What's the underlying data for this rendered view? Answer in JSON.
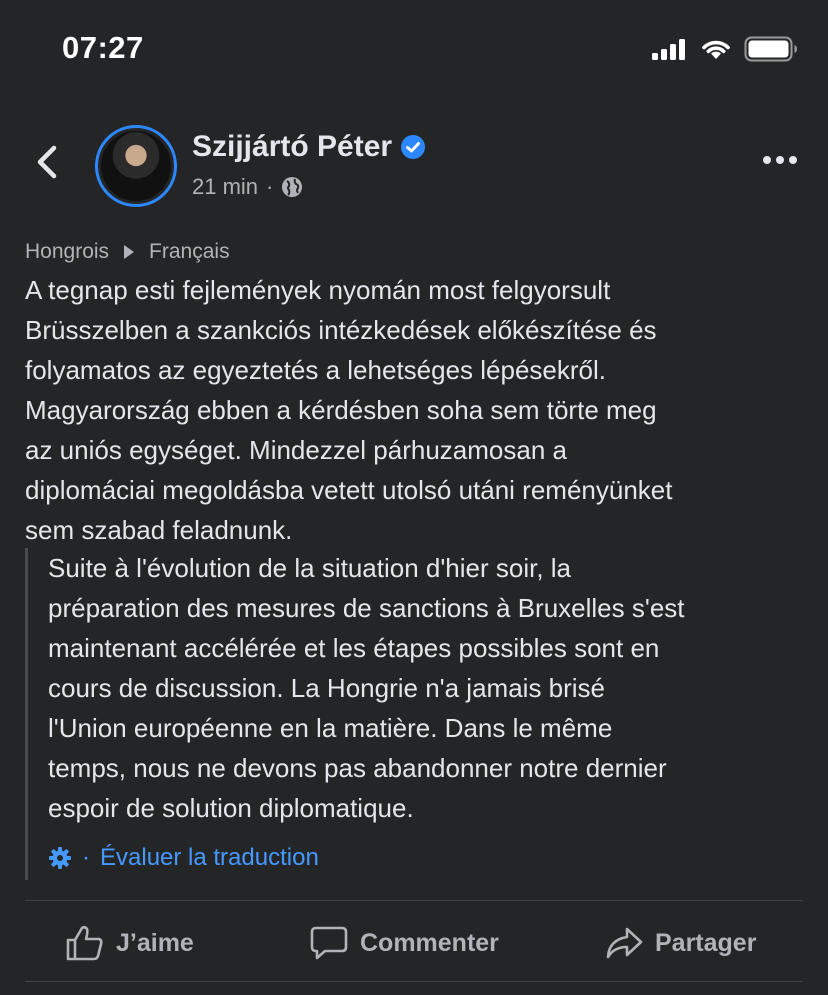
{
  "status_bar": {
    "time": "07:27"
  },
  "post": {
    "author": "Szijjártó Péter",
    "timestamp": "21 min",
    "separator": "·"
  },
  "translation": {
    "from_lang": "Hongrois",
    "to_lang": "Français",
    "original_lines": [
      "A tegnap esti fejlemények nyomán most felgyorsult",
      "Brüsszelben a szankciós intézkedések előkészítése és",
      "folyamatos az egyeztetés a lehetséges lépésekről.",
      "Magyarország ebben a kérdésben soha sem törte meg",
      "az uniós egységet. Mindezzel párhuzamosan a",
      "diplomáciai megoldásba vetett utolsó utáni reményünket",
      "sem szabad feladnunk."
    ],
    "translated_lines": [
      "Suite à l'évolution de la situation d'hier soir, la",
      "préparation des mesures de sanctions à Bruxelles s'est",
      "maintenant accélérée et les étapes possibles sont en",
      "cours de discussion. La Hongrie n'a jamais brisé",
      "l'Union européenne en la matière. Dans le même",
      "temps, nous ne devons pas abandonner notre dernier",
      "espoir de solution diplomatique."
    ],
    "rate_separator": "·",
    "rate_label": "Évaluer la traduction"
  },
  "actions": {
    "like_label": "J’aime",
    "comment_label": "Commenter",
    "share_label": "Partager"
  },
  "colors": {
    "background": "#242527",
    "text": "#e4e6eb",
    "secondary": "#b0b3b8",
    "accent": "#2d88ff",
    "link": "#4599ff"
  },
  "icons": [
    "signal-icon",
    "wifi-icon",
    "battery-icon",
    "back-chevron-icon",
    "verified-badge-icon",
    "globe-icon",
    "more-icon",
    "play-arrow-icon",
    "gear-icon",
    "like-icon",
    "comment-icon",
    "share-icon"
  ]
}
